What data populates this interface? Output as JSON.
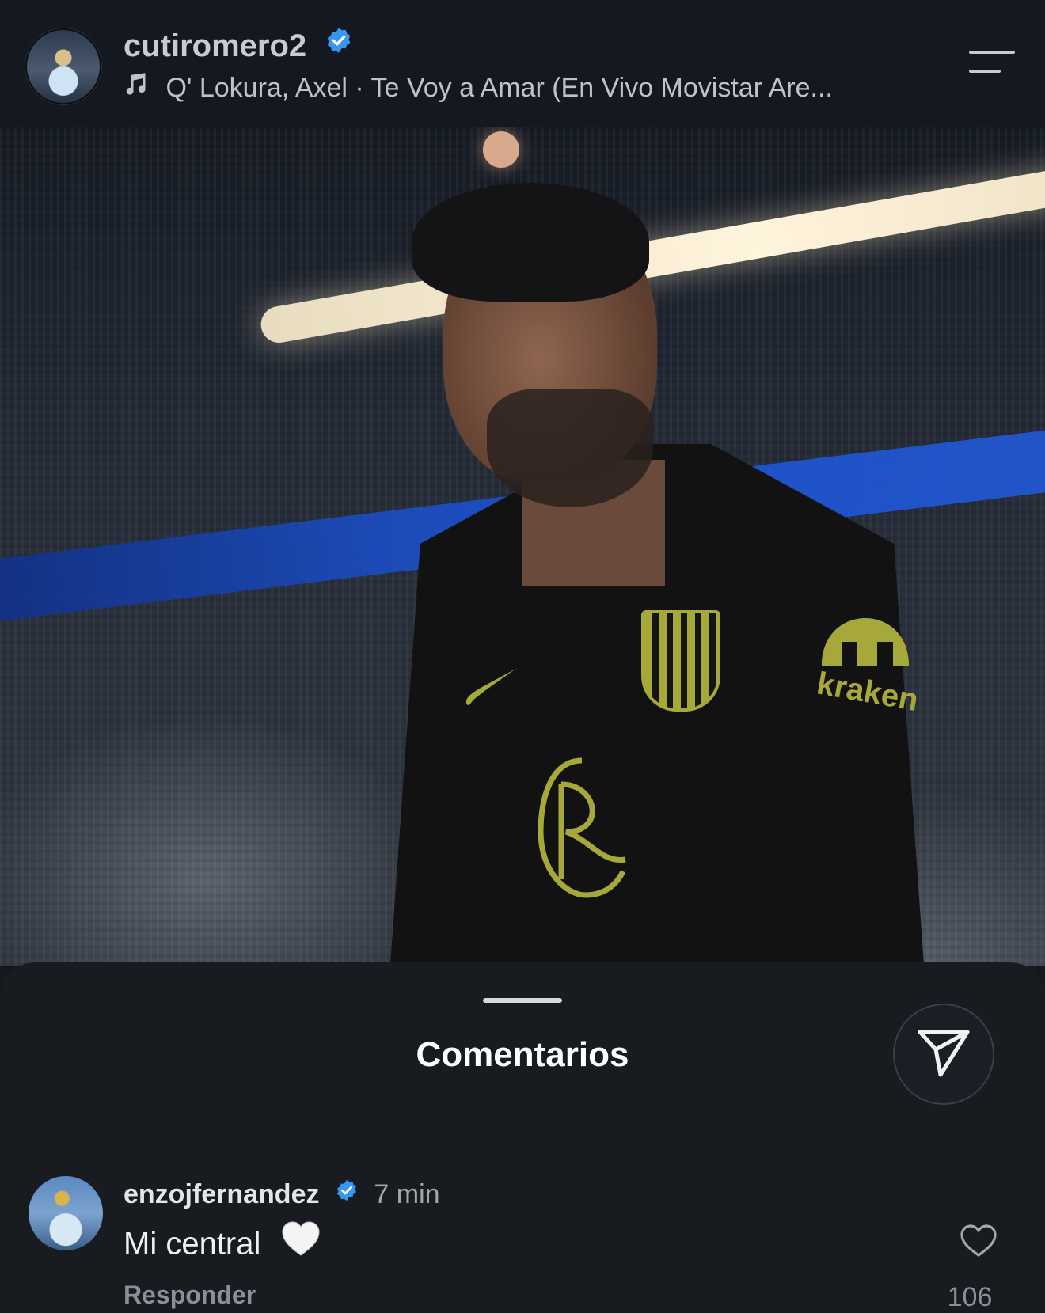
{
  "header": {
    "username": "cutiromero2",
    "music": "Q' Lokura, Axel · Te Voy a Amar (En Vivo Movistar Are..."
  },
  "post": {
    "sleeve_sponsor": "kraken"
  },
  "comments_sheet": {
    "title": "Comentarios",
    "comments": [
      {
        "username": "enzojfernandez",
        "time": "7 min",
        "text": "Mi central",
        "reply_label": "Responder",
        "likes": "106"
      }
    ]
  },
  "colors": {
    "verified": "#3897f0",
    "sheet_bg": "#181b20",
    "header_bg": "#141820"
  }
}
